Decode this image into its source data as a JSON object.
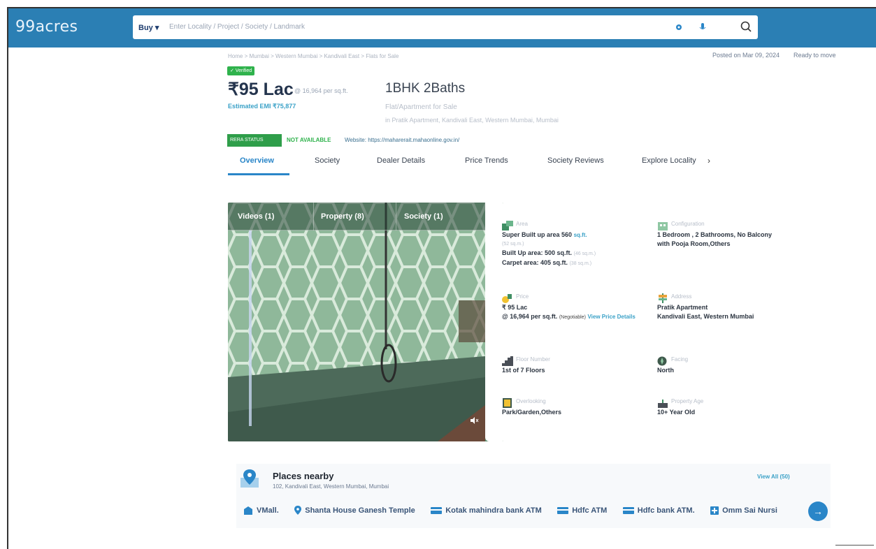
{
  "header": {
    "logo": "99acres",
    "buy_label": "Buy ▾",
    "search_placeholder": "Enter Locality / Project / Society / Landmark"
  },
  "meta": {
    "posted": "Posted on Mar 09, 2024",
    "status": "Ready to move",
    "breadcrumb": "Home > Mumbai > Western Mumbai > Kandivali East > Flats for Sale"
  },
  "listing": {
    "verified": "✓ Verified",
    "price": "₹95 Lac",
    "price_per_sqft": "@ 16,964 per sq.ft.",
    "emi": "Estimated EMI ₹75,877",
    "config": "1BHK 2Baths",
    "type": "Flat/Apartment for Sale",
    "address": "in Pratik Apartment, Kandivali East, Western Mumbai, Mumbai",
    "rera_label": "RERA STATUS",
    "rera_value": "NOT AVAILABLE",
    "website": "Website: https://maharerait.mahaonline.gov.in/"
  },
  "tabs": [
    "Overview",
    "Society",
    "Dealer Details",
    "Price Trends",
    "Society Reviews",
    "Explore Locality"
  ],
  "tab_more": "›",
  "media": {
    "tabs": [
      "Videos (1)",
      "Property (8)",
      "Society (1)"
    ]
  },
  "details": {
    "area": {
      "label": "Area",
      "line1": "Super Built up area 560",
      "unit": "sq.ft.",
      "line1_sub": "(52 sq.m.)",
      "line2": "Built Up area: 500 sq.ft.",
      "line2_sub": "(46 sq.m.)",
      "line3": "Carpet area: 405 sq.ft.",
      "line3_sub": "(38 sq.m.)"
    },
    "configuration": {
      "label": "Configuration",
      "line1": "1 Bedroom , 2 Bathrooms, No Balcony",
      "line2": "with Pooja Room,Others"
    },
    "price": {
      "label": "Price",
      "line1": "₹ 95 Lac",
      "line2": "@ 16,964 per sq.ft.",
      "line2_sub": "(Negotiable)",
      "link": "View Price Details"
    },
    "address": {
      "label": "Address",
      "line1": "Pratik Apartment",
      "line2": "Kandivali East, Western Mumbai"
    },
    "floor": {
      "label": "Floor Number",
      "value": "1st of 7 Floors"
    },
    "facing": {
      "label": "Facing",
      "value": "North"
    },
    "overlooking": {
      "label": "Overlooking",
      "value": "Park/Garden,Others"
    },
    "age": {
      "label": "Property Age",
      "value": "10+ Year Old"
    }
  },
  "places": {
    "title": "Places nearby",
    "subtitle": "102, Kandivali East, Western Mumbai, Mumbai",
    "view_all": "View All (50)",
    "items": [
      "VMall.",
      "Shanta House Ganesh Temple",
      "Kotak mahindra bank ATM",
      "Hdfc ATM",
      "Hdfc bank ATM.",
      "Omm Sai Nursi"
    ],
    "next": "→"
  },
  "colors": {
    "header_bg": "#2b7fb4",
    "accent": "#2a86c8",
    "green": "#2fb24c"
  }
}
